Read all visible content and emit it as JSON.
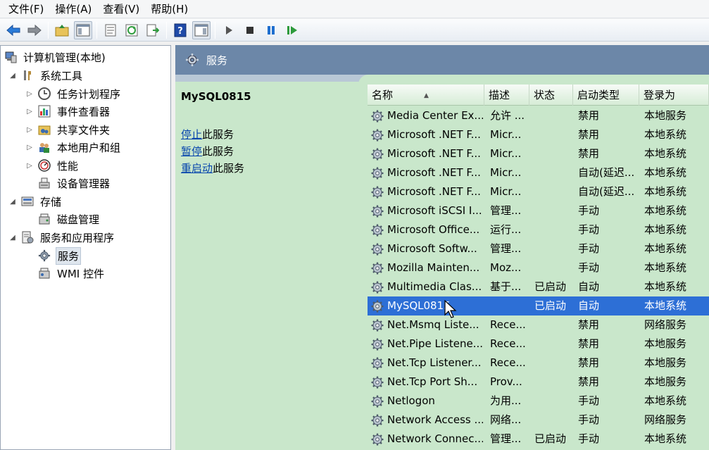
{
  "menu": [
    "文件(F)",
    "操作(A)",
    "查看(V)",
    "帮助(H)"
  ],
  "toolbar_icons": [
    "back-arrow-icon",
    "forward-arrow-icon",
    "up-folder-icon",
    "show-hide-tree-icon",
    "properties-icon",
    "refresh-icon",
    "export-list-icon",
    "help-icon",
    "show-action-pane-icon",
    "start-icon",
    "stop-icon",
    "pause-icon",
    "restart-icon"
  ],
  "tree": {
    "root": "计算机管理(本地)",
    "system_tools": "系统工具",
    "task_scheduler": "任务计划程序",
    "event_viewer": "事件查看器",
    "shared_folders": "共享文件夹",
    "local_users": "本地用户和组",
    "performance": "性能",
    "device_manager": "设备管理器",
    "storage": "存储",
    "disk_management": "磁盘管理",
    "services_apps": "服务和应用程序",
    "services": "服务",
    "wmi": "WMI 控件"
  },
  "panel": {
    "title": "服务",
    "selected_service": "MySQL0815",
    "actions": [
      {
        "link": "停止",
        "rest": "此服务"
      },
      {
        "link": "暂停",
        "rest": "此服务"
      },
      {
        "link": "重启动",
        "rest": "此服务"
      }
    ]
  },
  "table": {
    "headers": [
      "名称",
      "描述",
      "状态",
      "启动类型",
      "登录为"
    ],
    "rows": [
      [
        "Media Center Ex...",
        "允许 ...",
        "",
        "禁用",
        "本地服务"
      ],
      [
        "Microsoft .NET F...",
        "Micr...",
        "",
        "禁用",
        "本地系统"
      ],
      [
        "Microsoft .NET F...",
        "Micr...",
        "",
        "禁用",
        "本地系统"
      ],
      [
        "Microsoft .NET F...",
        "Micr...",
        "",
        "自动(延迟...",
        "本地系统"
      ],
      [
        "Microsoft .NET F...",
        "Micr...",
        "",
        "自动(延迟...",
        "本地系统"
      ],
      [
        "Microsoft iSCSI I...",
        "管理...",
        "",
        "手动",
        "本地系统"
      ],
      [
        "Microsoft Office...",
        "运行...",
        "",
        "手动",
        "本地系统"
      ],
      [
        "Microsoft Softw...",
        "管理...",
        "",
        "手动",
        "本地系统"
      ],
      [
        "Mozilla Mainten...",
        "Moz...",
        "",
        "手动",
        "本地系统"
      ],
      [
        "Multimedia Clas...",
        "基于...",
        "已启动",
        "自动",
        "本地系统"
      ],
      [
        "MySQL0815",
        "",
        "已启动",
        "自动",
        "本地系统"
      ],
      [
        "Net.Msmq Liste...",
        "Rece...",
        "",
        "禁用",
        "网络服务"
      ],
      [
        "Net.Pipe Listene...",
        "Rece...",
        "",
        "禁用",
        "本地服务"
      ],
      [
        "Net.Tcp Listener...",
        "Rece...",
        "",
        "禁用",
        "本地服务"
      ],
      [
        "Net.Tcp Port Sh...",
        "Prov...",
        "",
        "禁用",
        "本地服务"
      ],
      [
        "Netlogon",
        "为用...",
        "",
        "手动",
        "本地系统"
      ],
      [
        "Network Access ...",
        "网络...",
        "",
        "手动",
        "网络服务"
      ],
      [
        "Network Connec...",
        "管理...",
        "已启动",
        "手动",
        "本地系统"
      ]
    ],
    "selected_index": 10
  },
  "colors": {
    "panel_bg": "#c9e7cb",
    "header_bg": "#6c87a8",
    "selected_row": "#2d6fd6"
  }
}
